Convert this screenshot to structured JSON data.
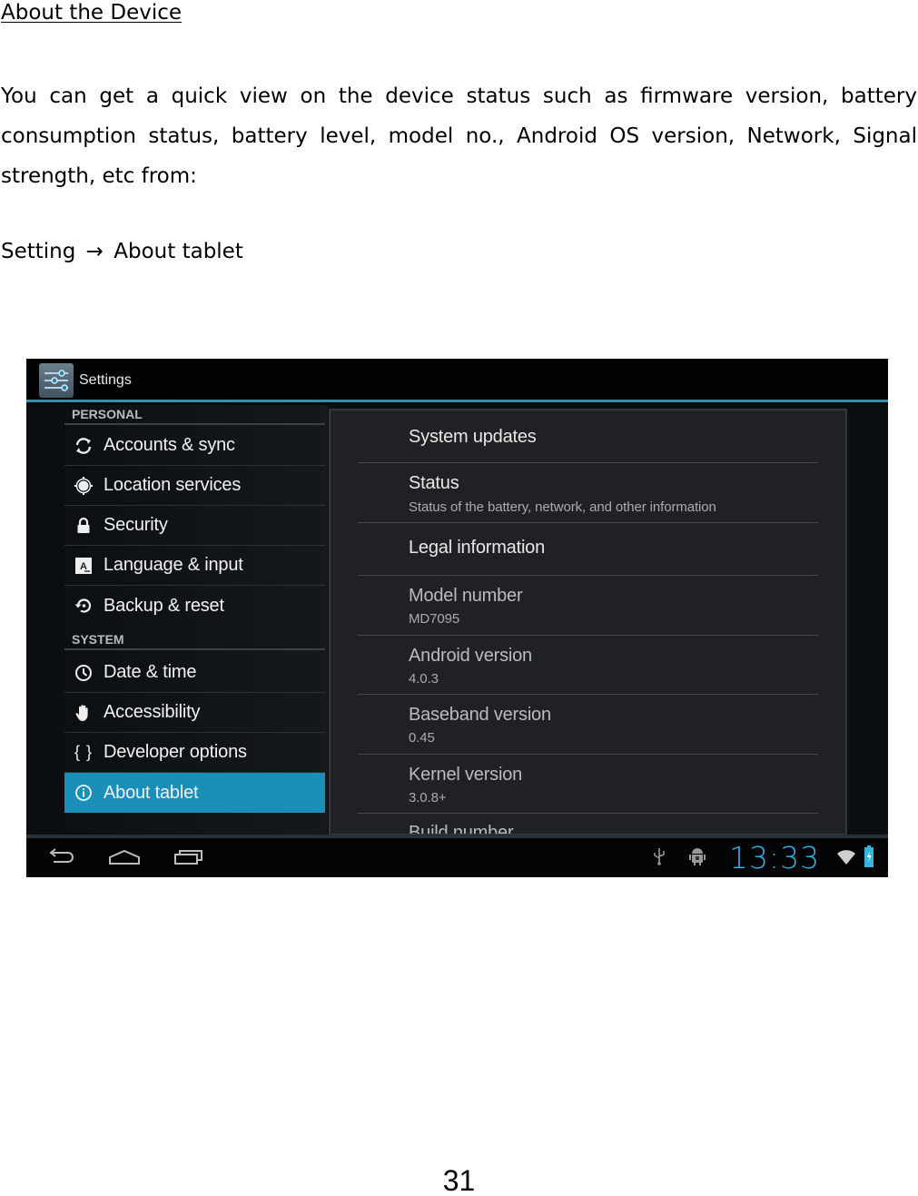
{
  "document": {
    "heading": "About the Device",
    "paragraph_lines": [
      "You can get a quick view on the device status such as firmware version, battery",
      "consumption status, battery level, model no., Android OS version, Network, Signal",
      "strength, etc from:"
    ],
    "path": {
      "from": "Setting",
      "arrow": "→",
      "to": "About tablet"
    },
    "page_number": "31"
  },
  "tablet": {
    "action_bar": {
      "title": "Settings",
      "icon": "settings-sliders-icon",
      "accent_color": "#3a8ea8"
    },
    "sidebar": {
      "sections": [
        {
          "header": "PERSONAL",
          "items": [
            {
              "label": "Accounts & sync",
              "icon": "sync-icon"
            },
            {
              "label": "Location services",
              "icon": "location-icon"
            },
            {
              "label": "Security",
              "icon": "lock-icon"
            },
            {
              "label": "Language & input",
              "icon": "keyboard-language-icon"
            },
            {
              "label": "Backup & reset",
              "icon": "backup-restore-icon"
            }
          ]
        },
        {
          "header": "SYSTEM",
          "items": [
            {
              "label": "Date & time",
              "icon": "clock-icon"
            },
            {
              "label": "Accessibility",
              "icon": "hand-icon"
            },
            {
              "label": "Developer options",
              "icon": "braces-icon",
              "glyph": "{ }"
            },
            {
              "label": "About tablet",
              "icon": "info-icon",
              "selected": true
            }
          ]
        }
      ],
      "selected_color": "#1a8fba"
    },
    "detail": {
      "items": [
        {
          "title": "System updates"
        },
        {
          "title": "Status",
          "subtitle": "Status of the battery, network, and other information"
        },
        {
          "title": "Legal information"
        },
        {
          "title": "Model number",
          "value": "MD7095"
        },
        {
          "title": "Android version",
          "value": "4.0.3"
        },
        {
          "title": "Baseband version",
          "value": "0.45"
        },
        {
          "title": "Kernel version",
          "value": "3.0.8+"
        },
        {
          "title": "Build number"
        }
      ]
    },
    "system_bar": {
      "buttons": [
        "back-button",
        "home-button",
        "recent-apps-button"
      ],
      "status_icons": [
        "usb-icon",
        "android-debug-icon",
        "wifi-icon",
        "battery-charging-icon"
      ],
      "clock": "13:33",
      "clock_color": "#35b4df"
    }
  }
}
